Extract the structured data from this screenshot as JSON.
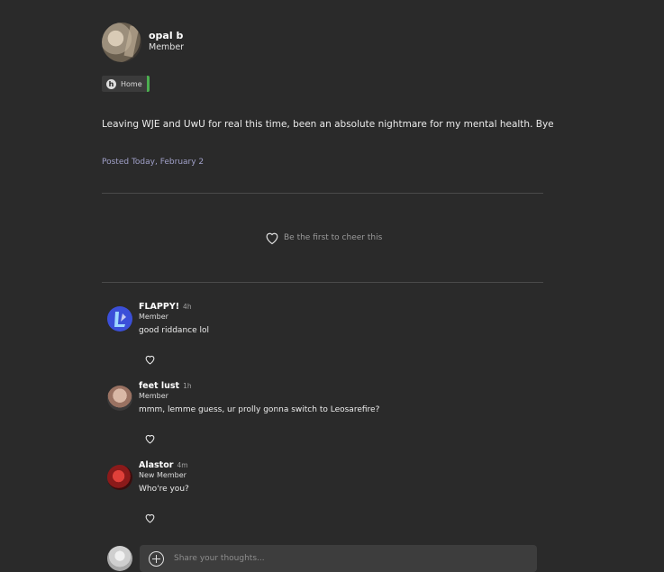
{
  "post": {
    "author_name": "opal b",
    "author_role": "Member",
    "tag": {
      "icon_letter": "h",
      "label": "Home",
      "accent": "#4caf50"
    },
    "body": "Leaving WJE and UwU for real this time, been an absolute nightmare for my mental health. Bye",
    "posted": "Posted Today, February 2",
    "cheer_prompt": "Be the first to cheer this"
  },
  "comments": [
    {
      "name": "FLAPPY!",
      "time": "4h",
      "role": "Member",
      "text": "good riddance lol",
      "avatar_color": "#3b4fd8"
    },
    {
      "name": "feet lust",
      "time": "1h",
      "role": "Member",
      "text": "mmm, lemme guess, ur prolly gonna switch to Leosarefire?",
      "avatar_color": "#b48a78"
    },
    {
      "name": "Alastor",
      "time": "4m",
      "role": "New Member",
      "text": "Who're you?",
      "avatar_color": "#8b1a1a"
    }
  ],
  "composer": {
    "placeholder": "Share your thoughts..."
  },
  "colors": {
    "background": "#2a2a2a",
    "posted_text": "#a0a0c8"
  }
}
